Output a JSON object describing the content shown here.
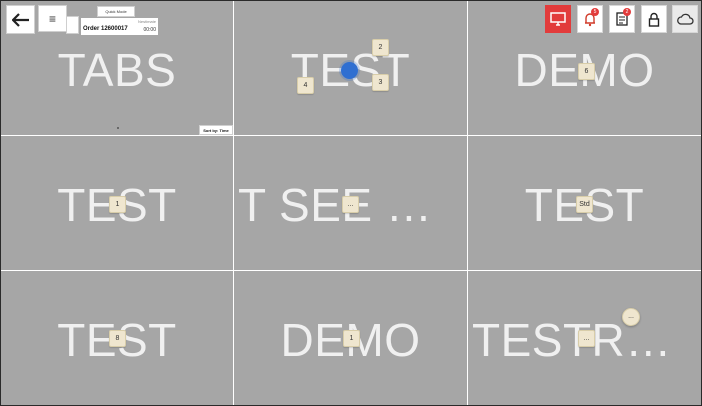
{
  "toolbar": {
    "quick_mode_label": "Quick Mode",
    "order_label": "Order 12600017",
    "order_tag": "Nestimate",
    "order_time": "00:00",
    "sort_label": "Sort by: Time",
    "icons": {
      "back": "back-arrow-icon",
      "menu": "menu-icon",
      "display": "monitor-icon",
      "notifications": "bell-icon",
      "orders": "receipt-icon",
      "lock": "lock-icon",
      "cloud": "cloud-icon"
    },
    "notification_count": "5",
    "orders_count": "2"
  },
  "colors": {
    "tile_bg": "#a6a6a6",
    "tile_text": "#f0f0f0",
    "accent_red": "#e23b3b",
    "blue_marker": "#2f6fd1",
    "badge_bg": "#efe6cf"
  },
  "tiles": [
    {
      "title": "TABS"
    },
    {
      "title": "TEST",
      "badges": [
        "2",
        "4",
        "3"
      ]
    },
    {
      "title": "DEMO",
      "badges": [
        "6"
      ]
    },
    {
      "title": "TEST",
      "badges": [
        "1"
      ]
    },
    {
      "title": "T SEE SO...",
      "badges": [
        "..."
      ]
    },
    {
      "title": "TEST",
      "badges": [
        "Std"
      ]
    },
    {
      "title": "TEST",
      "badges": [
        "8"
      ]
    },
    {
      "title": "DEMO",
      "badges": [
        "1"
      ]
    },
    {
      "title": "TESTRO...",
      "badges": [
        "..."
      ],
      "circle_badge": "..."
    }
  ]
}
